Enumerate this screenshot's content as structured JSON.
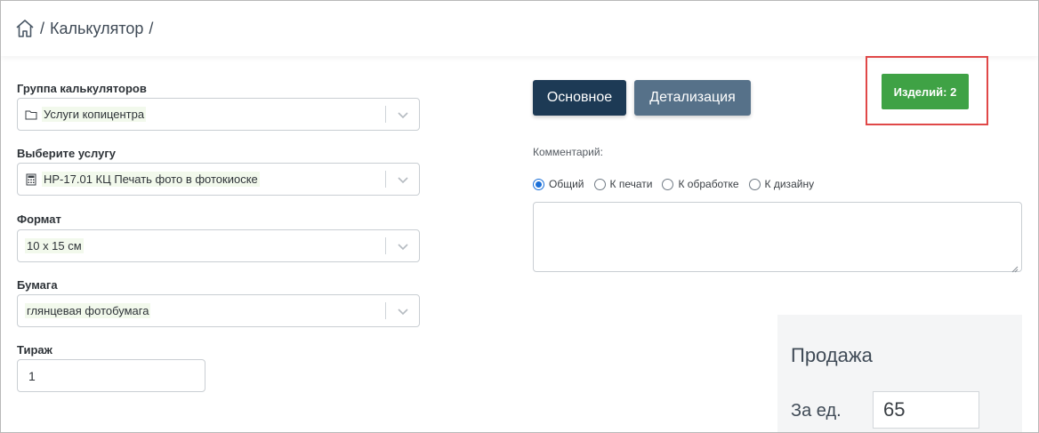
{
  "breadcrumb": {
    "home_icon": "home-icon",
    "separator": "/",
    "current": "Калькулятор",
    "trailing_separator": "/"
  },
  "form": {
    "group": {
      "label": "Группа калькуляторов",
      "value": "Услуги копицентра",
      "icon": "folder-icon"
    },
    "service": {
      "label": "Выберите услугу",
      "value": "HP-17.01 КЦ Печать фото в фотокиоске",
      "icon": "calculator-icon"
    },
    "format": {
      "label": "Формат",
      "value": "10 x 15 см"
    },
    "paper": {
      "label": "Бумага",
      "value": "глянцевая фотобумага"
    },
    "quantity": {
      "label": "Тираж",
      "value": "1"
    }
  },
  "tabs": {
    "main_label": "Основное",
    "detail_label": "Детализация"
  },
  "items_button": {
    "label": "Изделий: 2"
  },
  "comment": {
    "label": "Комментарий:",
    "options": [
      "Общий",
      "К печати",
      "К обработке",
      "К дизайну"
    ],
    "selected": "Общий"
  },
  "sale": {
    "title": "Продажа",
    "unit_label": "За ед.",
    "unit_value": "65"
  },
  "colors": {
    "primary": "#1d3a55",
    "secondary": "#567189",
    "success": "#3fa245",
    "highlight": "#e04848",
    "radio": "#1a6fd8"
  }
}
